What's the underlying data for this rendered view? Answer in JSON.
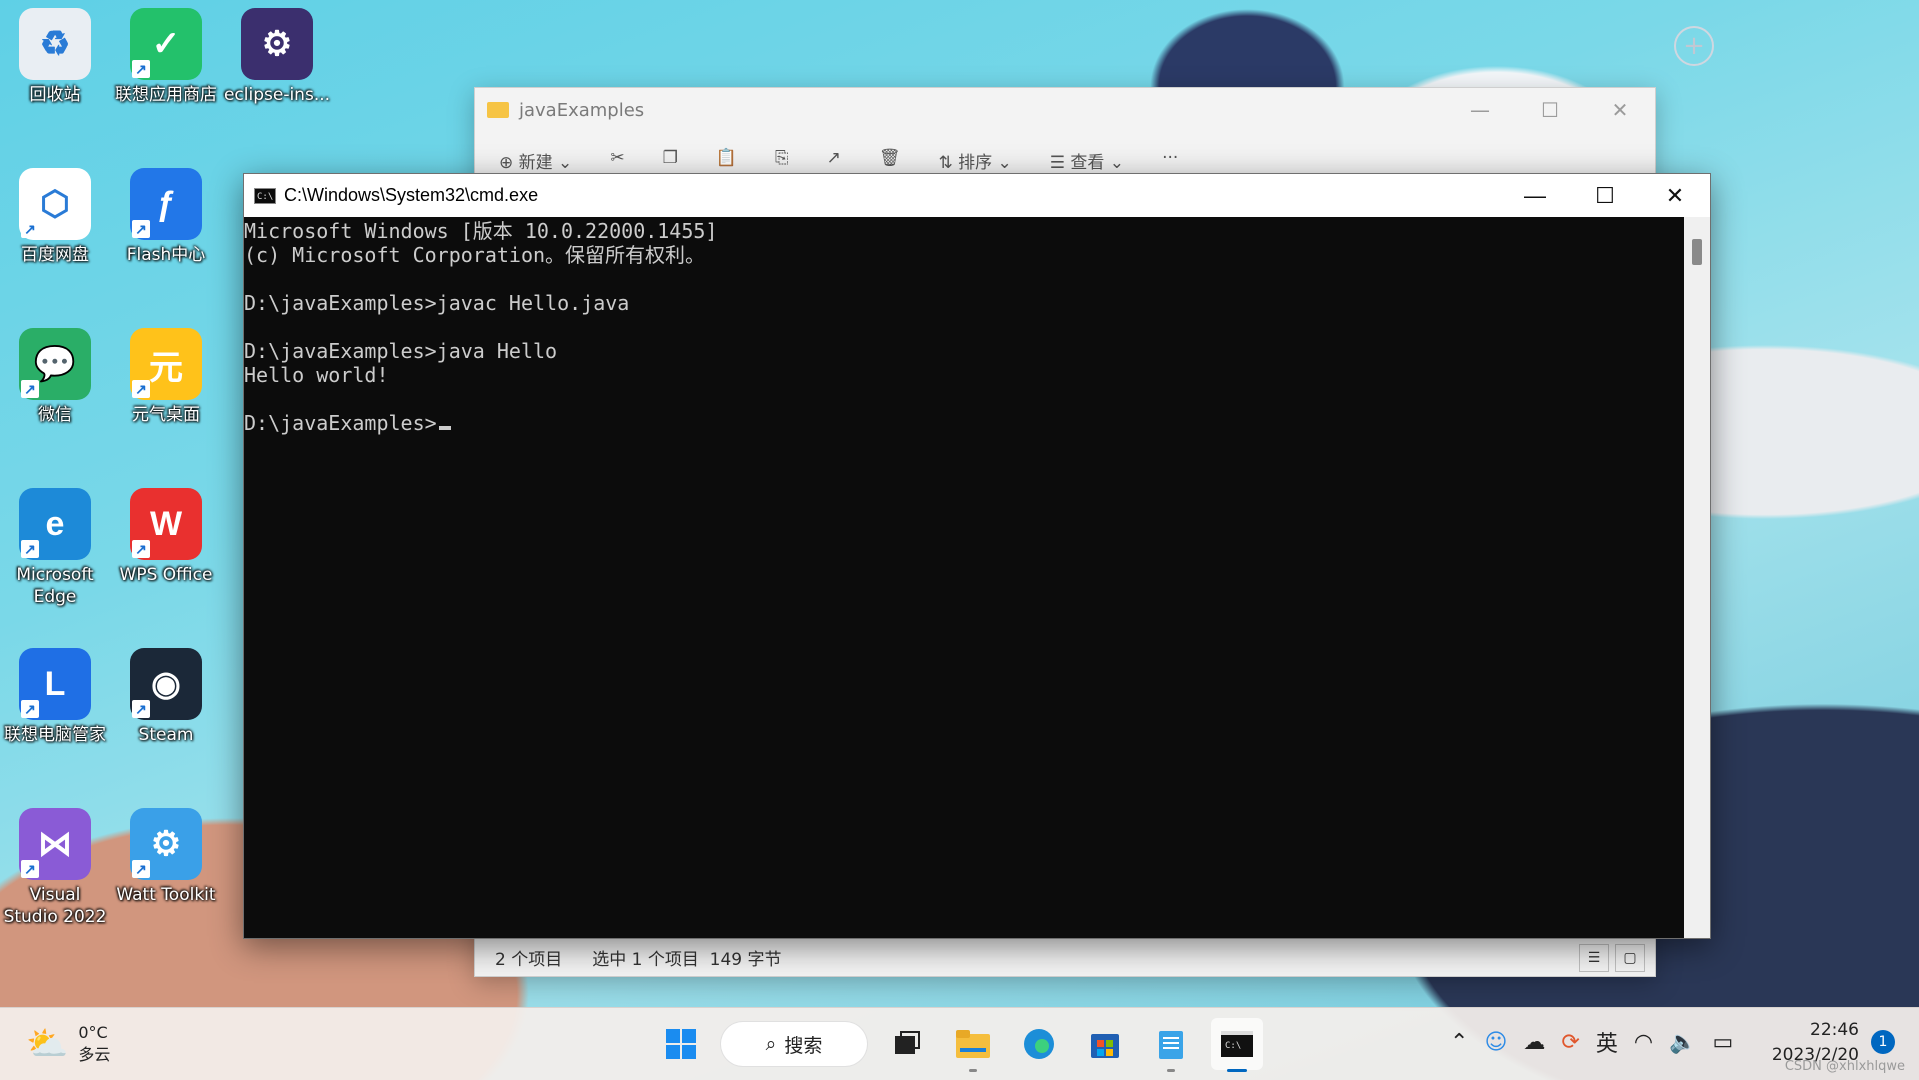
{
  "desktop": {
    "icons": [
      {
        "label": "回收站",
        "icon": "recycle-bin-icon",
        "color": "#e9eef3"
      },
      {
        "label": "联想应用商店",
        "icon": "app-store-icon",
        "color": "#23c16b"
      },
      {
        "label": "eclipse-ins...",
        "icon": "eclipse-installer-icon",
        "color": "#3b2f6e"
      },
      {
        "label": "百度网盘",
        "icon": "baidu-netdisk-icon",
        "color": "#ffffff"
      },
      {
        "label": "Flash中心",
        "icon": "flash-center-icon",
        "color": "#2277e8"
      },
      {
        "label": "微信",
        "icon": "wechat-icon",
        "color": "#2aae67"
      },
      {
        "label": "元气桌面",
        "icon": "yuanqi-desktop-icon",
        "color": "#ffc21a"
      },
      {
        "label": "Microsoft Edge",
        "icon": "edge-icon",
        "color": "#1d8ad8"
      },
      {
        "label": "WPS Office",
        "icon": "wps-office-icon",
        "color": "#e9302f"
      },
      {
        "label": "联想电脑管家",
        "icon": "lenovo-pc-manager-icon",
        "color": "#1f6fe5"
      },
      {
        "label": "Steam",
        "icon": "steam-icon",
        "color": "#1b2838"
      },
      {
        "label": "Visual Studio 2022",
        "icon": "visual-studio-icon",
        "color": "#8a5bd6"
      },
      {
        "label": "Watt Toolkit",
        "icon": "watt-toolkit-icon",
        "color": "#3aa0e8"
      }
    ]
  },
  "explorer": {
    "title": "javaExamples",
    "toolbar": {
      "new_label": "新建",
      "sort_label": "排序",
      "view_label": "查看"
    },
    "status": {
      "item_count": "2 个项目",
      "selection": "选中 1 个项目",
      "size": "149 字节"
    }
  },
  "cmd": {
    "title": "C:\\Windows\\System32\\cmd.exe",
    "lines": [
      "Microsoft Windows [版本 10.0.22000.1455]",
      "(c) Microsoft Corporation。保留所有权利。",
      "",
      "D:\\javaExamples>javac Hello.java",
      "",
      "D:\\javaExamples>java Hello",
      "Hello world!",
      "",
      "D:\\javaExamples>"
    ]
  },
  "taskbar": {
    "weather": {
      "temp": "0°C",
      "condition": "多云"
    },
    "search_label": "搜索",
    "ime": "英",
    "time": "22:46",
    "date": "2023/2/20",
    "notification_count": "1",
    "watermark": "CSDN @xhlxhlqwe"
  },
  "colors": {
    "console_bg": "#0c0c0c",
    "console_fg": "#cccccc",
    "accent": "#0067c0"
  }
}
